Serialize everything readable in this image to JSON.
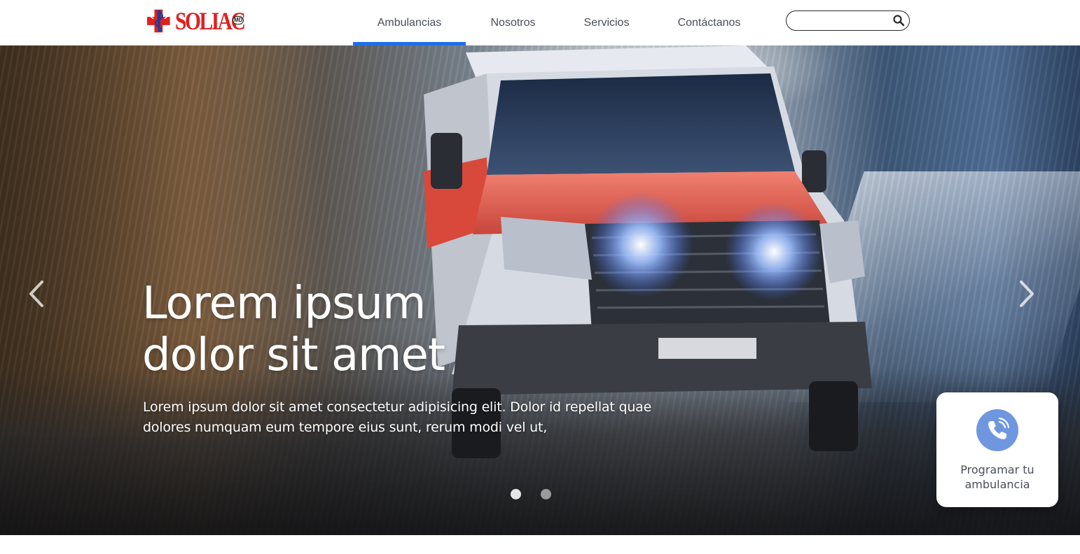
{
  "header": {
    "logo": {
      "text": "SOLIAC",
      "mark": "MD"
    },
    "nav": [
      {
        "label": "Ambulancias",
        "active": true
      },
      {
        "label": "Nosotros",
        "active": false
      },
      {
        "label": "Servicios",
        "active": false
      },
      {
        "label": "Contáctanos",
        "active": false
      }
    ],
    "search": {
      "value": "",
      "placeholder": "",
      "icon": "search-icon"
    }
  },
  "hero": {
    "title_line1": "Lorem ipsum",
    "title_line2": "dolor sit amet",
    "text": "Lorem ipsum dolor sit amet consectetur adipisicing elit. Dolor id repellat quae dolores numquam eum tempore eius sunt, rerum modi vel ut,",
    "prev_icon": "chevron-left-icon",
    "next_icon": "chevron-right-icon",
    "slides": [
      {
        "active": true
      },
      {
        "active": false
      }
    ]
  },
  "cta": {
    "label_line1": "Programar tu",
    "label_line2": "ambulancia",
    "icon": "phone-call-icon"
  },
  "colors": {
    "accent": "#1e6fe8",
    "logo_red": "#e02020",
    "logo_blue": "#1b3e9c",
    "nav_text": "#4a4f57",
    "cta_circle": "#6e97e0",
    "dot_active": "#e6e6e6",
    "dot_inactive": "#9a9a9a"
  }
}
